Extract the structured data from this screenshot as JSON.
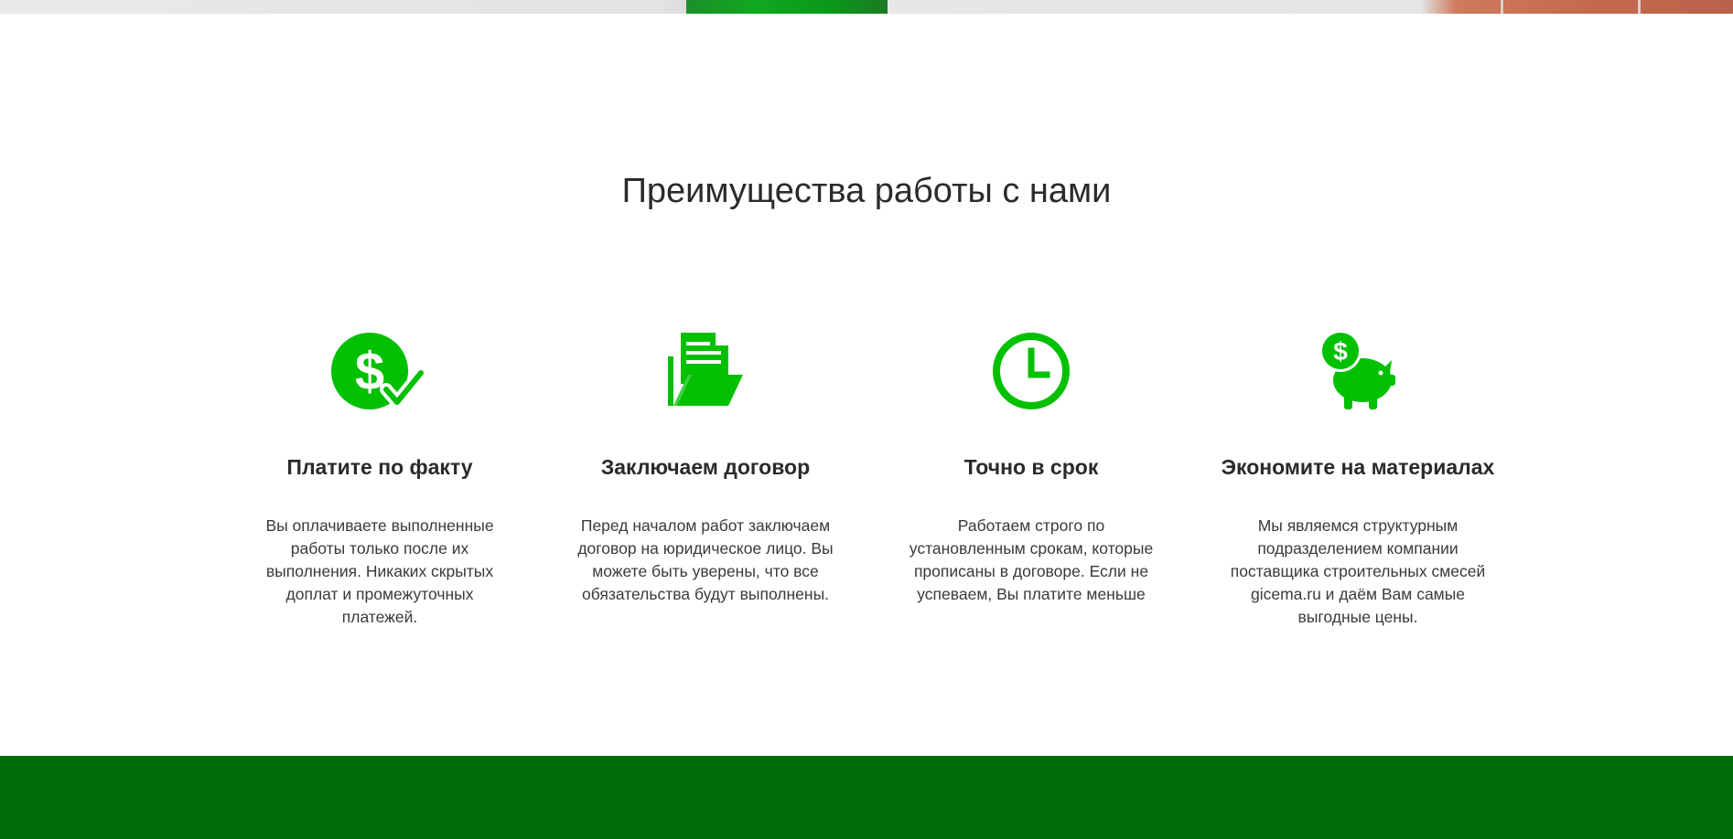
{
  "section": {
    "title": "Преимущества работы с нами"
  },
  "features": [
    {
      "icon": "dollar-check-icon",
      "title": "Платите по факту",
      "description": "Вы оплачиваете выполненные работы только после их выполнения. Никаких скрытых доплат и промежуточных платежей."
    },
    {
      "icon": "document-folder-icon",
      "title": "Заключаем договор",
      "description": "Перед началом работ заключаем договор на юридическое лицо. Вы можете быть уверены, что все обязательства будут выполнены."
    },
    {
      "icon": "clock-icon",
      "title": "Точно в срок",
      "description": "Работаем строго по установленным срокам, которые прописаны в договоре. Если не успеваем, Вы платите меньше"
    },
    {
      "icon": "piggy-bank-icon",
      "title": "Экономите на материалах",
      "description": "Мы являемся структурным подразделением компании поставщика строительных смесей gicema.ru и даём Вам самые выгодные цены."
    }
  ],
  "colors": {
    "accent": "#00c000",
    "footer": "#006d08",
    "text": "#2b2b2b"
  }
}
